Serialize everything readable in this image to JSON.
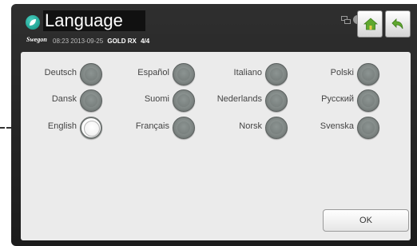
{
  "header": {
    "title": "Language",
    "brand": "Swegon",
    "time": "08:23",
    "date": "2013-09-25",
    "model": "GOLD RX",
    "unit": "4/4",
    "app_icon": "swegon-leaf-icon",
    "accent": "#1aa898"
  },
  "toolbar": {
    "home_icon": "home-icon",
    "back_icon": "back-arrow-icon",
    "network_icon": "network-icon",
    "user_icon": "user-icon"
  },
  "languages": [
    {
      "label": "Deutsch",
      "selected": false
    },
    {
      "label": "Español",
      "selected": false
    },
    {
      "label": "Italiano",
      "selected": false
    },
    {
      "label": "Polski",
      "selected": false
    },
    {
      "label": "Dansk",
      "selected": false
    },
    {
      "label": "Suomi",
      "selected": false
    },
    {
      "label": "Nederlands",
      "selected": false
    },
    {
      "label": "Русский",
      "selected": false
    },
    {
      "label": "English",
      "selected": true
    },
    {
      "label": "Français",
      "selected": false
    },
    {
      "label": "Norsk",
      "selected": false
    },
    {
      "label": "Svenska",
      "selected": false
    }
  ],
  "actions": {
    "ok_label": "OK"
  }
}
